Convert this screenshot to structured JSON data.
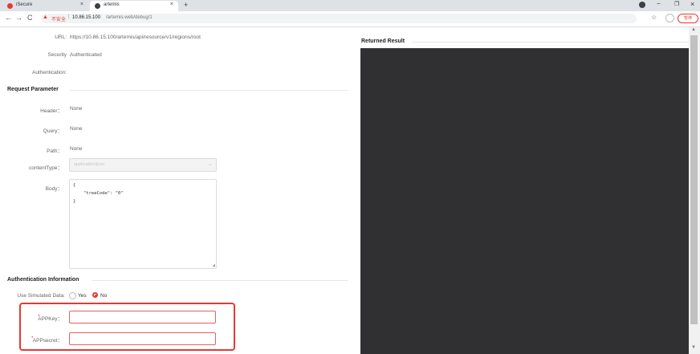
{
  "browser": {
    "tabs": [
      {
        "title": "iSecure",
        "close": "×"
      },
      {
        "title": "artemis",
        "close": "×"
      }
    ],
    "new_tab": "+",
    "insecure_label": "不安全",
    "url_host": "10.86.15.100",
    "url_path": "/artemis-web/debug/1",
    "ext_badge": "暂停",
    "window_controls": {
      "minimize": "−",
      "restore": "❐",
      "close": "×"
    }
  },
  "colors": {
    "danger": "#e53935",
    "result_bg": "#303033",
    "highlight": "#e53935"
  },
  "request": {
    "url_label": "URL:",
    "url_value": "https://10.86.15.100/artemis/api/resource/v1/regions/root",
    "security_label": "Security",
    "security_value": "Authenticated",
    "authentication_label": "Authentication:"
  },
  "request_parameter": {
    "heading": "Request Parameter",
    "header_label": "Header：",
    "header_value": "None",
    "query_label": "Query：",
    "query_value": "None",
    "path_label": "Path：",
    "path_value": "None",
    "content_type_label": "contentType：",
    "content_type_value": "application/json",
    "body_label": "Body：",
    "body_lines": [
      "{",
      "\"treeCode\": \"0\"",
      "}"
    ]
  },
  "auth_info": {
    "heading": "Authentication Information",
    "simulated_label": "Use Simulated Data:",
    "option_yes": "Yes",
    "option_no": "No",
    "appkey_label": "APPKey：",
    "appsecret_label": "APPsecret：",
    "appkey_value": "",
    "appsecret_value": ""
  },
  "result": {
    "heading": "Returned Result"
  }
}
